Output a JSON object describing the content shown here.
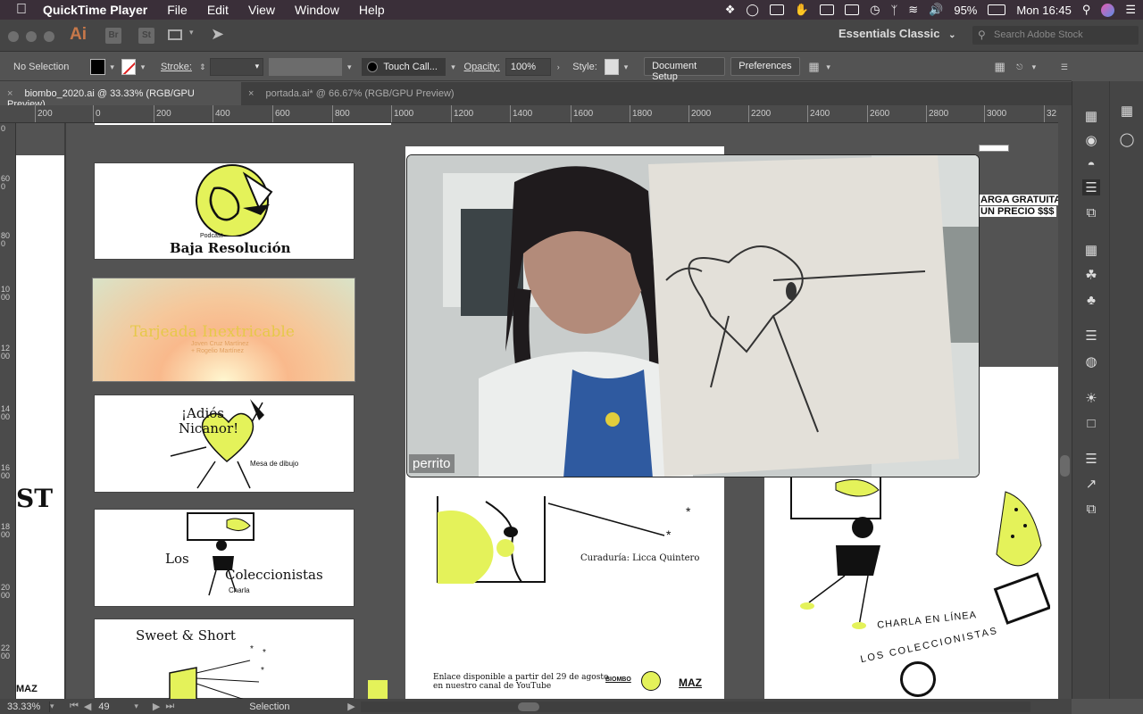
{
  "menubar": {
    "app": "QuickTime Player",
    "menus": [
      "File",
      "Edit",
      "View",
      "Window",
      "Help"
    ],
    "battery": "95%",
    "clock": "Mon 16:45"
  },
  "appbar": {
    "logo": "Ai",
    "bridge": "Br",
    "stock": "St",
    "workspace": "Essentials Classic",
    "search_placeholder": "Search Adobe Stock"
  },
  "control": {
    "selection": "No Selection",
    "stroke_label": "Stroke:",
    "brush": "Touch Call...",
    "opacity_label": "Opacity:",
    "opacity_value": "100%",
    "style_label": "Style:",
    "doc_setup": "Document Setup",
    "preferences": "Preferences"
  },
  "tabs": [
    {
      "label": "biombo_2020.ai @ 33.33% (RGB/GPU Preview)"
    },
    {
      "label": "portada.ai* @ 66.67% (RGB/GPU Preview)"
    }
  ],
  "ruler": {
    "h": [
      "200",
      "0",
      "200",
      "400",
      "600",
      "800",
      "1000",
      "1200",
      "1400",
      "1600",
      "1800",
      "2000",
      "2200",
      "2400",
      "2600",
      "2800",
      "3000",
      "32"
    ],
    "v": [
      "0",
      "6 0 0",
      "8 0 0",
      "1 0 0 0",
      "1 2 0 0",
      "1 4 0 0",
      "1 6 0 0",
      "1 8 0 0",
      "2 0 0 0",
      "2 2 0 0"
    ]
  },
  "artboards": {
    "podcast_small": "Podcast",
    "podcast_title": "Baja Resolución",
    "sunset_title": "Tarjeada Inextricable",
    "sunset_sub1": "Joven Cruz Martínez",
    "sunset_sub2": "+ Rogelio Martínez",
    "adios_title1": "¡Adiós",
    "adios_title2": "Nicanor!",
    "adios_sub": "Mesa de dibujo",
    "colec1": "Los",
    "colec2": "Coleccionistas",
    "colec_sub": "Charla",
    "sweet_title": "Sweet & Short",
    "left_st": "ST",
    "left_maz": "MAZ",
    "curaduria": "Curaduría: Licca Quintero",
    "enlace1": "Enlace disponible a partir del 29 de agosto",
    "enlace2": "en nuestro canal de YouTube",
    "biombo": "BIOMBO",
    "maz": "MAZ",
    "charla1": "CHARLA EN LÍNEA",
    "charla2": "LOS COLECCIONISTAS",
    "descarga1": "ARGA GRATUITA",
    "descarga2": "UN PRECIO $$$"
  },
  "video": {
    "name": "perrito"
  },
  "status": {
    "zoom": "33.33%",
    "page": "49",
    "tool": "Selection"
  },
  "colors": {
    "accent_yellow": "#e4f25a",
    "menubar": "#3a2f39",
    "panel": "#535353"
  }
}
